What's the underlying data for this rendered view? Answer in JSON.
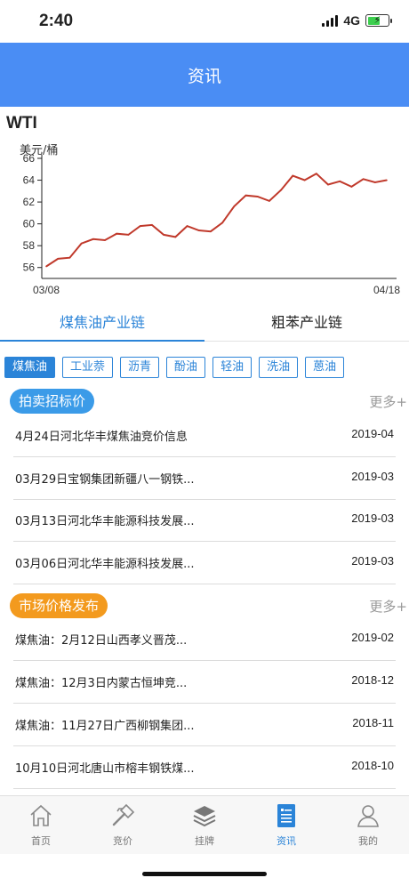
{
  "status": {
    "time": "2:40",
    "network": "4G"
  },
  "header": {
    "title": "资讯"
  },
  "chart_data": {
    "type": "line",
    "title": "WTI",
    "ylabel": "美元/桶",
    "ylim": [
      55,
      66
    ],
    "yticks": [
      56,
      58,
      60,
      62,
      64,
      66
    ],
    "xticks": [
      "03/08",
      "04/18"
    ],
    "color": "#c0392b",
    "values": [
      56.1,
      56.8,
      56.9,
      58.2,
      58.6,
      58.5,
      59.1,
      59.0,
      59.8,
      59.9,
      59.0,
      58.8,
      59.8,
      59.4,
      59.3,
      60.1,
      61.6,
      62.6,
      62.5,
      62.1,
      63.1,
      64.4,
      64.0,
      64.6,
      63.6,
      63.9,
      63.4,
      64.1,
      63.8,
      64.0
    ]
  },
  "tabs": [
    {
      "label": "煤焦油产业链",
      "active": true
    },
    {
      "label": "粗苯产业链",
      "active": false
    }
  ],
  "chips": [
    {
      "label": "煤焦油",
      "active": true
    },
    {
      "label": "工业萘",
      "active": false
    },
    {
      "label": "沥青",
      "active": false
    },
    {
      "label": "酚油",
      "active": false
    },
    {
      "label": "轻油",
      "active": false
    },
    {
      "label": "洗油",
      "active": false
    },
    {
      "label": "蒽油",
      "active": false
    }
  ],
  "auction": {
    "title": "拍卖招标价",
    "color": "#3b9be8",
    "more": "更多+",
    "items": [
      {
        "title": "4月24日河北华丰煤焦油竞价信息",
        "date": "2019-04"
      },
      {
        "title": "03月29日宝钢集团新疆八一钢铁...",
        "date": "2019-03"
      },
      {
        "title": "03月13日河北华丰能源科技发展...",
        "date": "2019-03"
      },
      {
        "title": "03月06日河北华丰能源科技发展...",
        "date": "2019-03"
      }
    ]
  },
  "market": {
    "title": "市场价格发布",
    "color": "#f39a1e",
    "more": "更多+",
    "items": [
      {
        "title": "煤焦油：2月12日山西孝义晋茂...",
        "date": "2019-02"
      },
      {
        "title": "煤焦油：12月3日内蒙古恒坤竞...",
        "date": "2018-12"
      },
      {
        "title": "煤焦油：11月27日广西柳钢集团...",
        "date": "2018-11"
      },
      {
        "title": "10月10日河北唐山市榕丰钢铁煤...",
        "date": "2018-10"
      }
    ]
  },
  "tabbar": [
    {
      "label": "首页",
      "icon": "home-icon",
      "active": false
    },
    {
      "label": "竞价",
      "icon": "hammer-icon",
      "active": false
    },
    {
      "label": "挂牌",
      "icon": "layers-icon",
      "active": false
    },
    {
      "label": "资讯",
      "icon": "news-icon",
      "active": true
    },
    {
      "label": "我的",
      "icon": "user-icon",
      "active": false
    }
  ]
}
